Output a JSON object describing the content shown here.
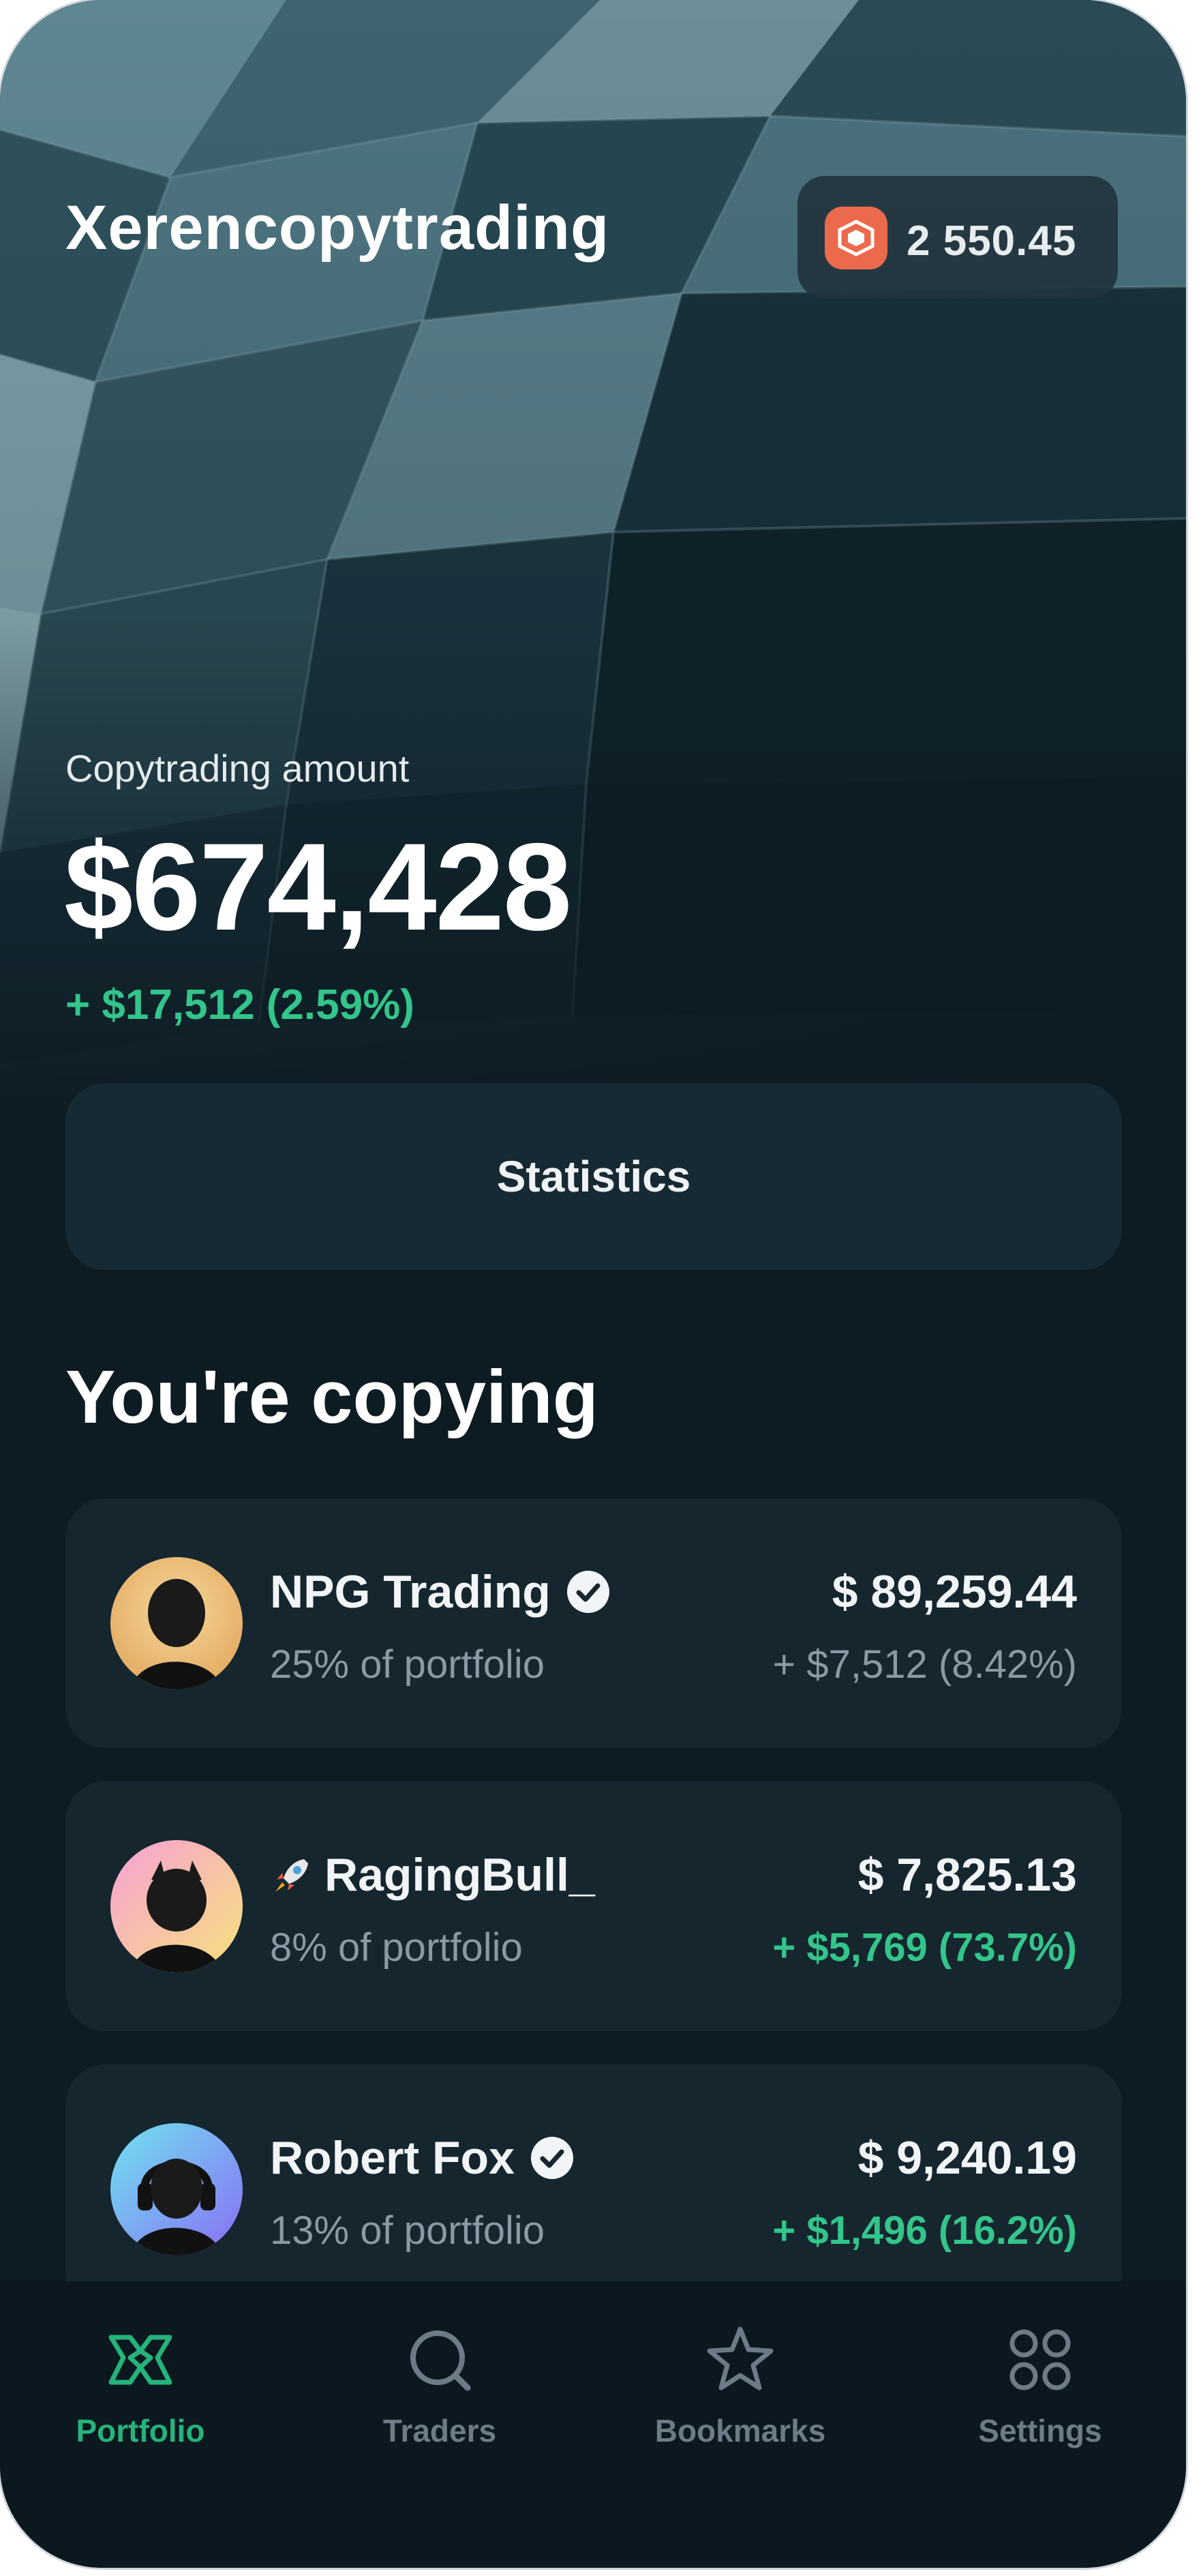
{
  "app": {
    "title": "Xerencopytrading"
  },
  "balance_chip": {
    "value": "2 550.45",
    "icon": "token-icon",
    "accent": "#ec6a4c"
  },
  "portfolio": {
    "label": "Copytrading amount",
    "amount": "$674,428",
    "change": "+ $17,512 (2.59%)"
  },
  "statistics_button": {
    "label": "Statistics"
  },
  "copying": {
    "title": "You're copying",
    "traders": [
      {
        "name": "NPG Trading",
        "verified": true,
        "share": "25% of portfolio",
        "value": "$ 89,259.44",
        "change": "+ $7,512 (8.42%)",
        "change_color": "#8a99a3"
      },
      {
        "name": "RagingBull_",
        "emoji": "rocket-icon",
        "verified": false,
        "share": "8% of portfolio",
        "value": "$ 7,825.13",
        "change": "+ $5,769 (73.7%)",
        "change_color": "#33c58a"
      },
      {
        "name": "Robert Fox",
        "verified": true,
        "share": "13% of portfolio",
        "value": "$ 9,240.19",
        "change": "+ $1,496 (16.2%)",
        "change_color": "#33c58a"
      }
    ]
  },
  "nav": {
    "items": [
      {
        "label": "Portfolio",
        "icon": "portfolio-icon",
        "active": true
      },
      {
        "label": "Traders",
        "icon": "traders-icon",
        "active": false
      },
      {
        "label": "Bookmarks",
        "icon": "bookmarks-icon",
        "active": false
      },
      {
        "label": "Settings",
        "icon": "settings-icon",
        "active": false
      }
    ]
  },
  "colors": {
    "background": "#0d1b23",
    "card": "#15262f",
    "positive": "#33c58a",
    "active_nav": "#25b37a"
  }
}
